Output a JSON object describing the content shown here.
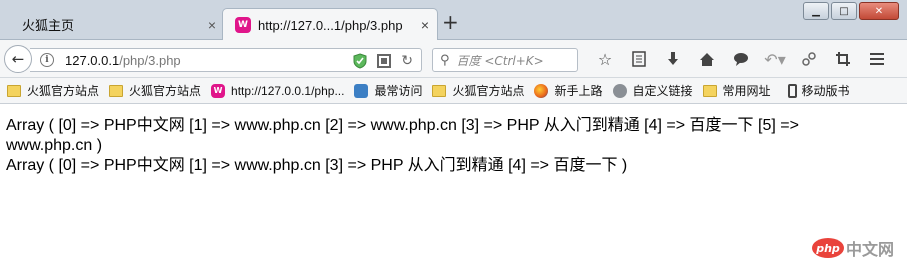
{
  "tabs": [
    {
      "title": "火狐主页",
      "close": "×"
    },
    {
      "title": "http://127.0...1/php/3.php",
      "close": "×",
      "icon": "W"
    }
  ],
  "new_tab": "+",
  "window_controls": {
    "minimize": "▁",
    "maximize": "□",
    "close": "✕"
  },
  "navbar": {
    "back": "←",
    "url_host": "127.0.0.1",
    "url_path": "/php/3.php",
    "search_placeholder": "百度 <Ctrl+K>",
    "reload": "↻"
  },
  "bookmarks": [
    {
      "label": "火狐官方站点",
      "icon": "folder-icon"
    },
    {
      "label": "火狐官方站点",
      "icon": "folder-icon"
    },
    {
      "label": "http://127.0.0.1/php...",
      "icon": "wamp-icon"
    },
    {
      "label": "最常访问",
      "icon": "gear-icon"
    },
    {
      "label": "火狐官方站点",
      "icon": "folder-icon"
    },
    {
      "label": "新手上路",
      "icon": "firefox-icon"
    },
    {
      "label": "自定义链接",
      "icon": "globe-icon"
    },
    {
      "label": "常用网址",
      "icon": "folder-icon"
    },
    {
      "label": "移动版书",
      "icon": "mobile-icon"
    }
  ],
  "content": {
    "line1": "Array ( [0] => PHP中文网 [1] => www.php.cn [2] => www.php.cn [3] => PHP 从入门到精通 [4] => 百度一下 [5] =>",
    "line2": "www.php.cn )",
    "line3": "Array ( [0] => PHP中文网 [1] => www.php.cn [3] => PHP 从入门到精通 [4] => 百度一下 )"
  },
  "watermark": {
    "logo": "php",
    "text": "中文网"
  }
}
